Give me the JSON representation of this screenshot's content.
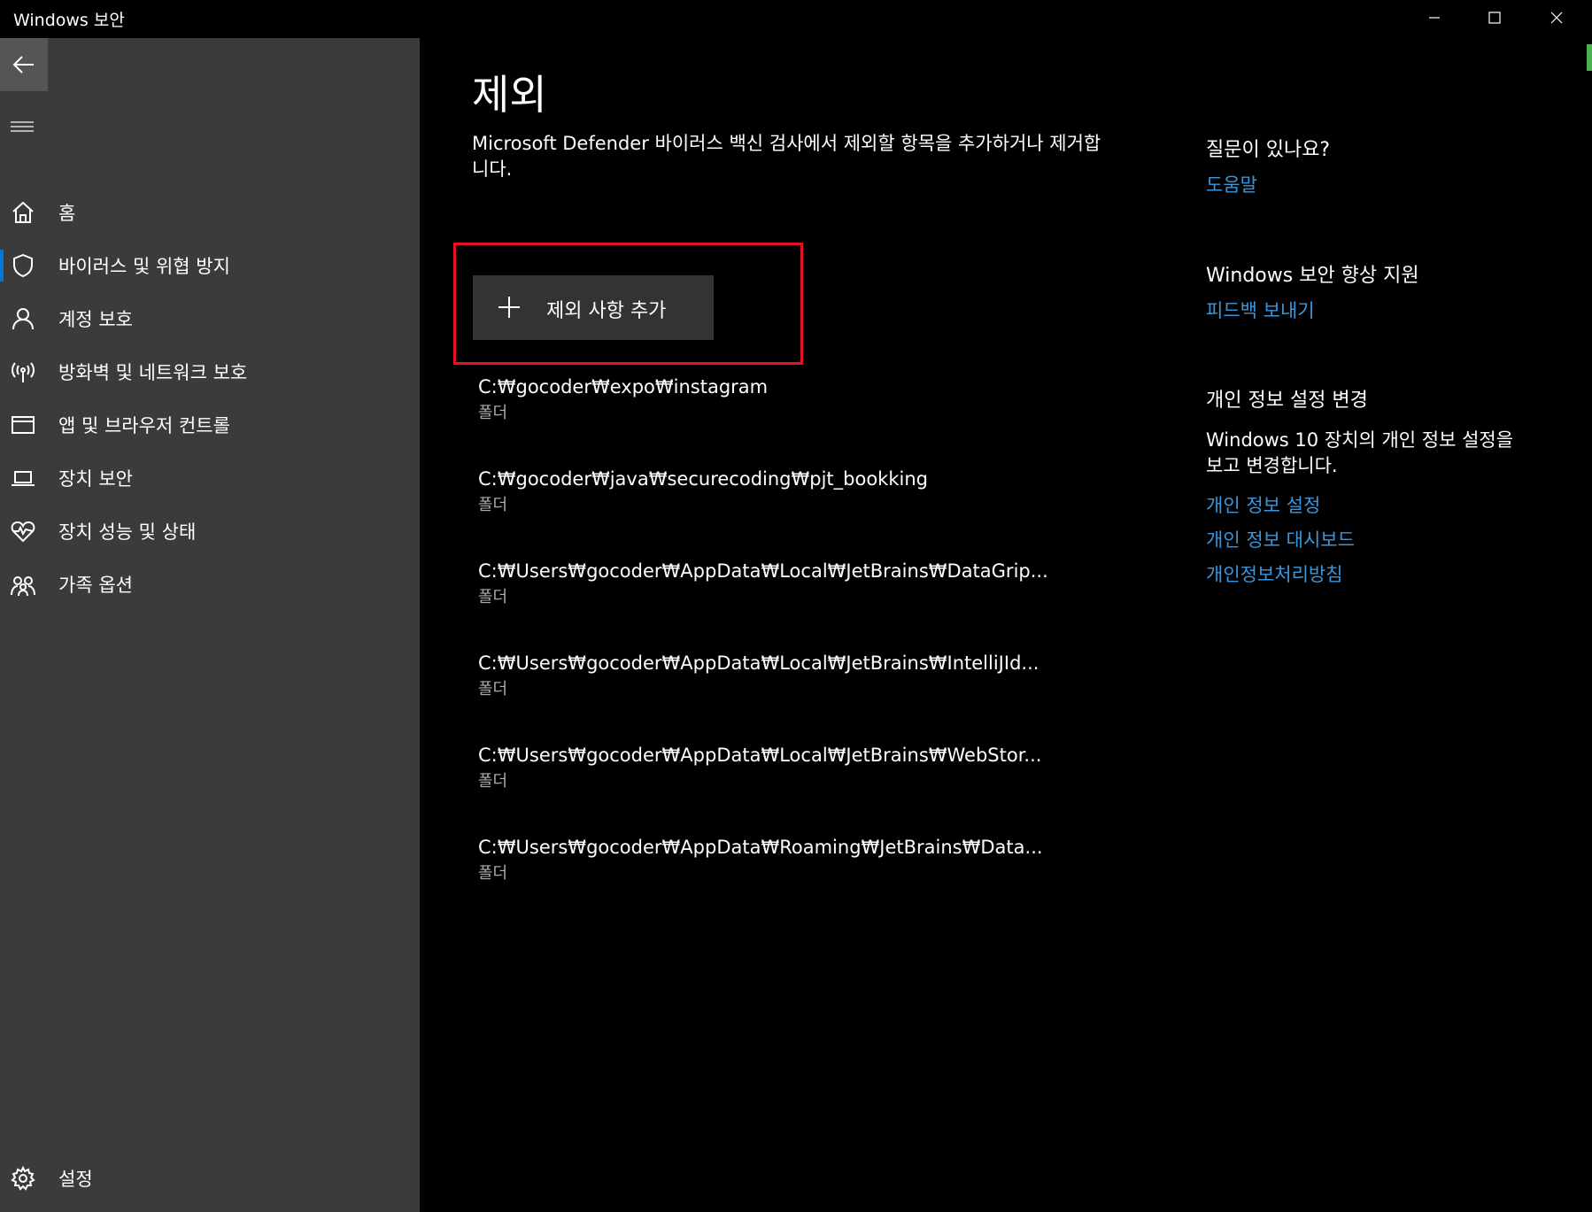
{
  "window": {
    "title": "Windows 보안"
  },
  "sidebar": {
    "items": [
      {
        "label": "홈",
        "icon": "home-icon"
      },
      {
        "label": "바이러스 및 위협 방지",
        "icon": "shield-icon",
        "active": true
      },
      {
        "label": "계정 보호",
        "icon": "person-icon"
      },
      {
        "label": "방화벽 및 네트워크 보호",
        "icon": "wireless-icon"
      },
      {
        "label": "앱 및 브라우저 컨트롤",
        "icon": "browser-window-icon"
      },
      {
        "label": "장치 보안",
        "icon": "laptop-icon"
      },
      {
        "label": "장치 성능 및 상태",
        "icon": "heart-pulse-icon"
      },
      {
        "label": "가족 옵션",
        "icon": "family-icon"
      }
    ],
    "settings_label": "설정"
  },
  "main": {
    "title": "제외",
    "description": "Microsoft Defender 바이러스 백신 검사에서 제외할 항목을 추가하거나 제거합니다.",
    "add_button_label": "제외 사항 추가",
    "exclusions": [
      {
        "path": "C:₩gocoder₩expo₩instagram",
        "type": "폴더"
      },
      {
        "path": "C:₩gocoder₩java₩securecoding₩pjt_bookking",
        "type": "폴더"
      },
      {
        "path": "C:₩Users₩gocoder₩AppData₩Local₩JetBrains₩DataGrip...",
        "type": "폴더"
      },
      {
        "path": "C:₩Users₩gocoder₩AppData₩Local₩JetBrains₩IntelliJId...",
        "type": "폴더"
      },
      {
        "path": "C:₩Users₩gocoder₩AppData₩Local₩JetBrains₩WebStor...",
        "type": "폴더"
      },
      {
        "path": "C:₩Users₩gocoder₩AppData₩Roaming₩JetBrains₩Data...",
        "type": "폴더"
      }
    ]
  },
  "right": {
    "question_heading": "질문이 있나요?",
    "help_link": "도움말",
    "improve_heading": "Windows 보안 향상 지원",
    "feedback_link": "피드백 보내기",
    "privacy_heading": "개인 정보 설정 변경",
    "privacy_text": "Windows 10 장치의 개인 정보 설정을 보고 변경합니다.",
    "privacy_links": [
      "개인 정보 설정",
      "개인 정보 대시보드",
      "개인정보처리방침"
    ]
  },
  "colors": {
    "sidebar_bg": "#3b3b3b",
    "content_bg": "#000000",
    "link": "#3a96dd",
    "highlight_box": "#e81123",
    "accent": "#0078d7"
  }
}
